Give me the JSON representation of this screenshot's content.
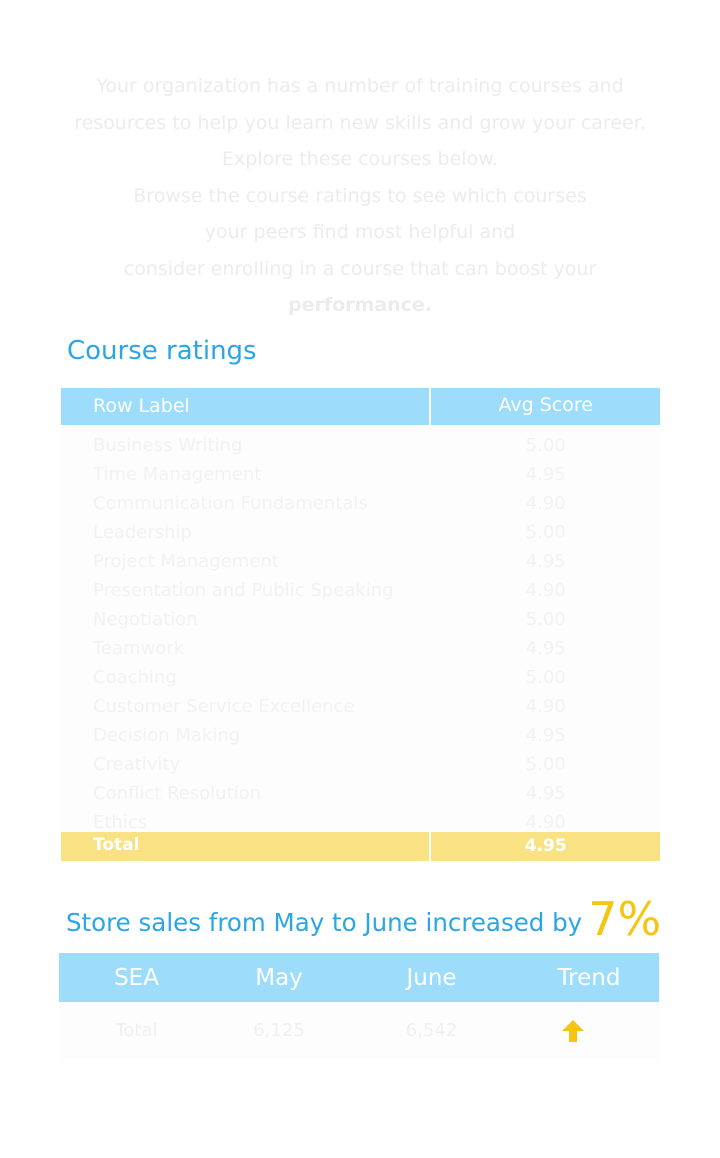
{
  "intro": {
    "lines": [
      "Your organization has a number of training courses and",
      "resources to help you learn new skills and grow your career.",
      "Explore these courses below.",
      "Browse the course ratings to see which courses",
      "your peers find most helpful and",
      "consider enrolling in a course that can boost your",
      "performance."
    ]
  },
  "course_ratings": {
    "title": "Course ratings",
    "headers": {
      "row_label": "Row Label",
      "avg_score": "Avg Score"
    },
    "rows": [
      {
        "label": "Business Writing",
        "score": "5.00"
      },
      {
        "label": "Time Management",
        "score": "4.95"
      },
      {
        "label": "Communication Fundamentals",
        "score": "4.90"
      },
      {
        "label": "Leadership",
        "score": "5.00"
      },
      {
        "label": "Project Management",
        "score": "4.95"
      },
      {
        "label": "Presentation and Public Speaking",
        "score": "4.90"
      },
      {
        "label": "Negotiation",
        "score": "5.00"
      },
      {
        "label": "Teamwork",
        "score": "4.95"
      },
      {
        "label": "Coaching",
        "score": "5.00"
      },
      {
        "label": "Customer Service Excellence",
        "score": "4.90"
      },
      {
        "label": "Decision Making",
        "score": "4.95"
      },
      {
        "label": "Creativity",
        "score": "5.00"
      },
      {
        "label": "Conflict Resolution",
        "score": "4.95"
      },
      {
        "label": "Ethics",
        "score": "4.90"
      }
    ],
    "total": {
      "label": "Total",
      "score": "4.95"
    }
  },
  "store_sales": {
    "title": "Store sales from May to June increased by",
    "percent": "7%",
    "headers": {
      "sea": "SEA",
      "may": "May",
      "june": "June",
      "trend": "Trend"
    },
    "row": {
      "sea": "Total",
      "may": "6,125",
      "june": "6,542"
    },
    "trend_icon": "arrow-up-icon",
    "trend_color": "#f5c512"
  },
  "colors": {
    "header_blue": "#9ddcfb",
    "title_blue": "#2aa6e6",
    "total_yellow": "#f8e283",
    "accent_yellow": "#f5c512"
  }
}
